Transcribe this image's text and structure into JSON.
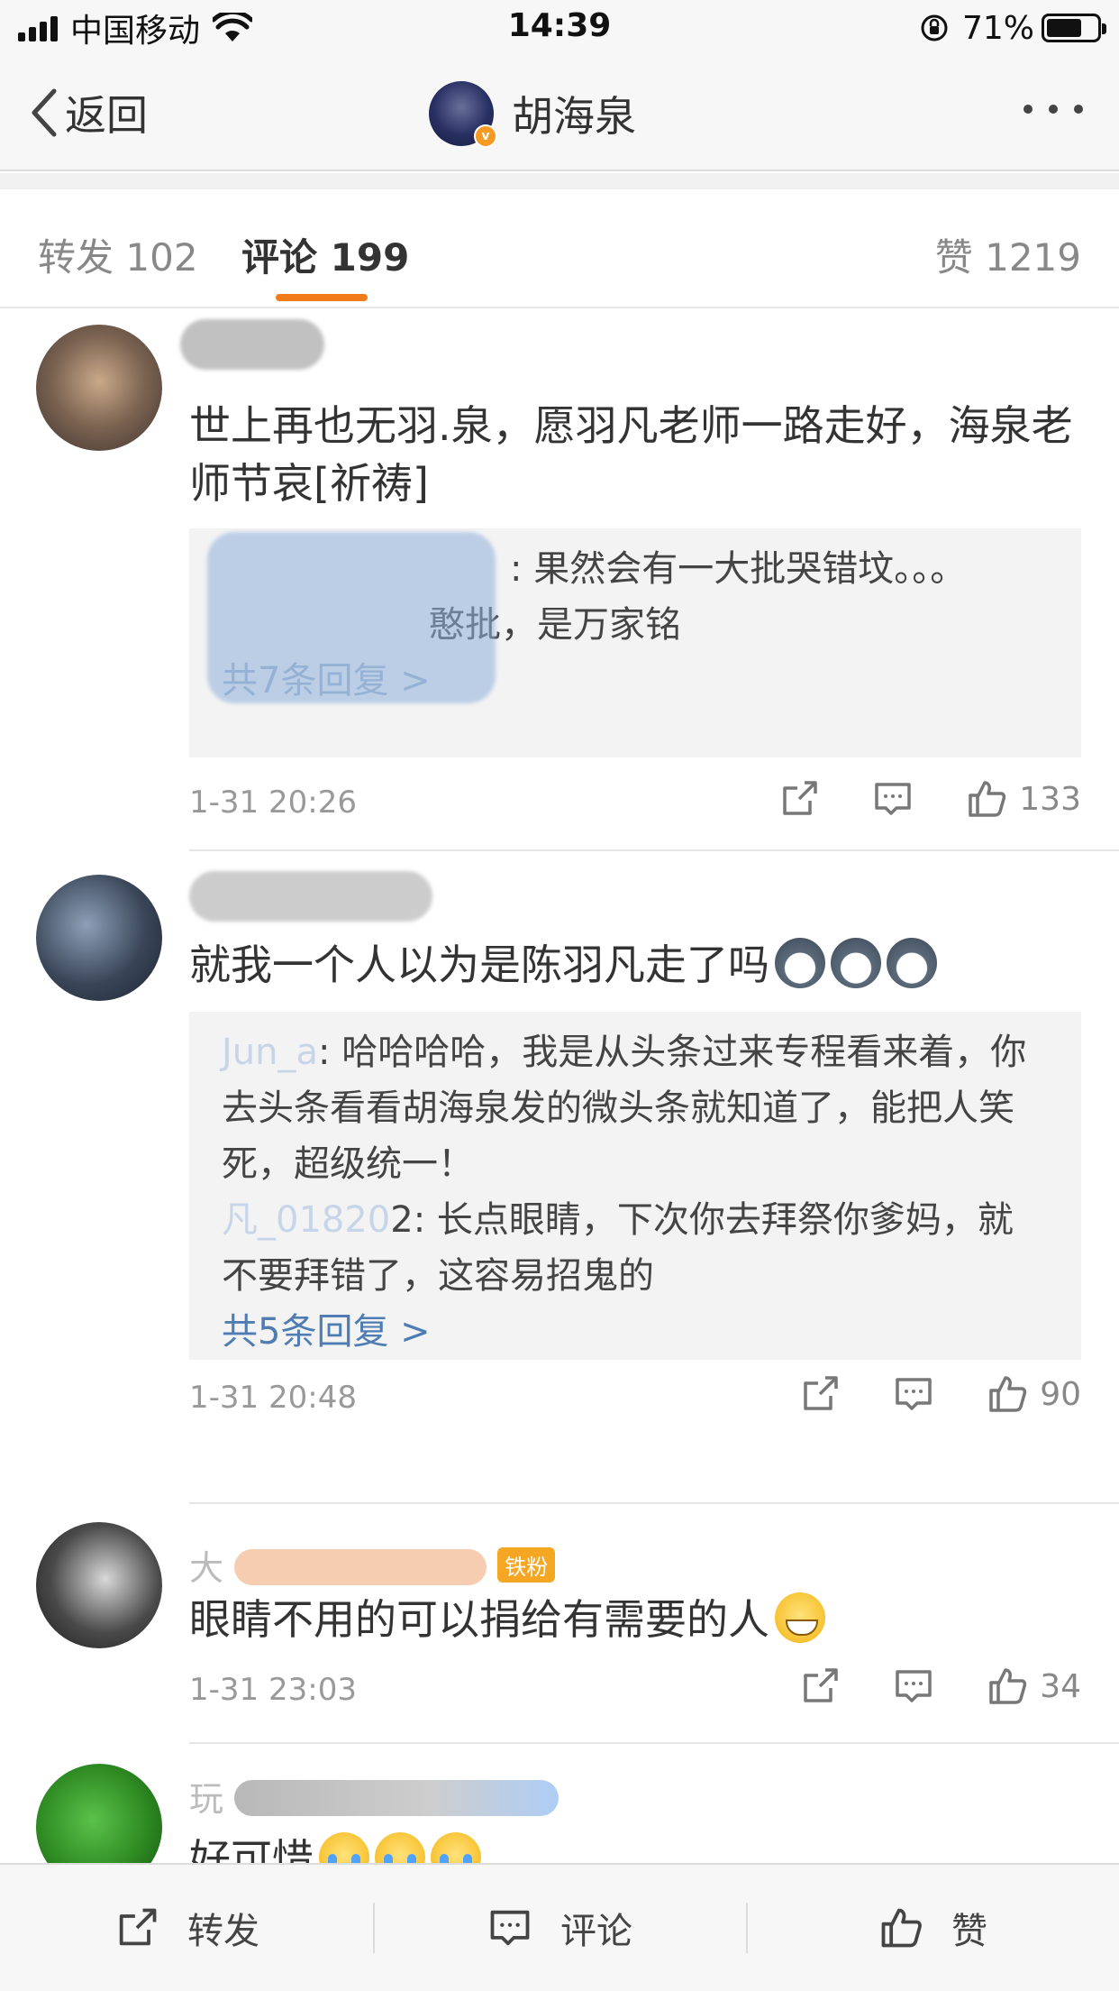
{
  "status_bar": {
    "carrier": "中国移动",
    "time": "14:39",
    "battery": "71%",
    "battery_level": 0.71
  },
  "navbar": {
    "back_label": "返回",
    "title": "胡海泉"
  },
  "tabs": [
    {
      "label": "转发",
      "count": "102"
    },
    {
      "label": "评论",
      "count": "199",
      "active": true
    },
    {
      "label": "赞",
      "count": "1219"
    }
  ],
  "comments": [
    {
      "text": "世上再也无羽.泉，愿羽凡老师一路走好，海泉老师节哀[祈祷]",
      "replies": [
        {
          "author": "",
          "text": ": 果然会有一大批哭错坟。。。"
        },
        {
          "author": "",
          "text": "憨批，是万家铭"
        }
      ],
      "more_replies": "共7条回复 >",
      "time": "1-31 20:26",
      "likes": "133"
    },
    {
      "text": "就我一个人以为是陈羽凡走了吗",
      "replies": [
        {
          "author": "Jun_a",
          "text": ": 哈哈哈哈，我是从头条过来专程看来着，你去头条看看胡海泉发的微头条就知道了，能把人笑死，超级统一！"
        },
        {
          "author": "凡_01820",
          "text": "2: 长点眼睛，下次你去拜祭你爹妈，就不要拜错了，这容易招鬼的"
        }
      ],
      "more_replies": "共5条回复 >",
      "time": "1-31 20:48",
      "likes": "90"
    },
    {
      "author": "大",
      "badge": "铁粉",
      "text": "眼睛不用的可以捐给有需要的人",
      "time": "1-31 23:03",
      "likes": "34"
    },
    {
      "author": "玩",
      "text": "好可惜"
    }
  ],
  "toolbar": {
    "repost": "转发",
    "comment": "评论",
    "like": "赞"
  },
  "colors": {
    "accent": "#f27c1a",
    "link": "#4f7db3"
  },
  "icons": [
    "back-chevron-icon",
    "more-icon",
    "repost-icon",
    "comment-icon",
    "like-icon"
  ]
}
